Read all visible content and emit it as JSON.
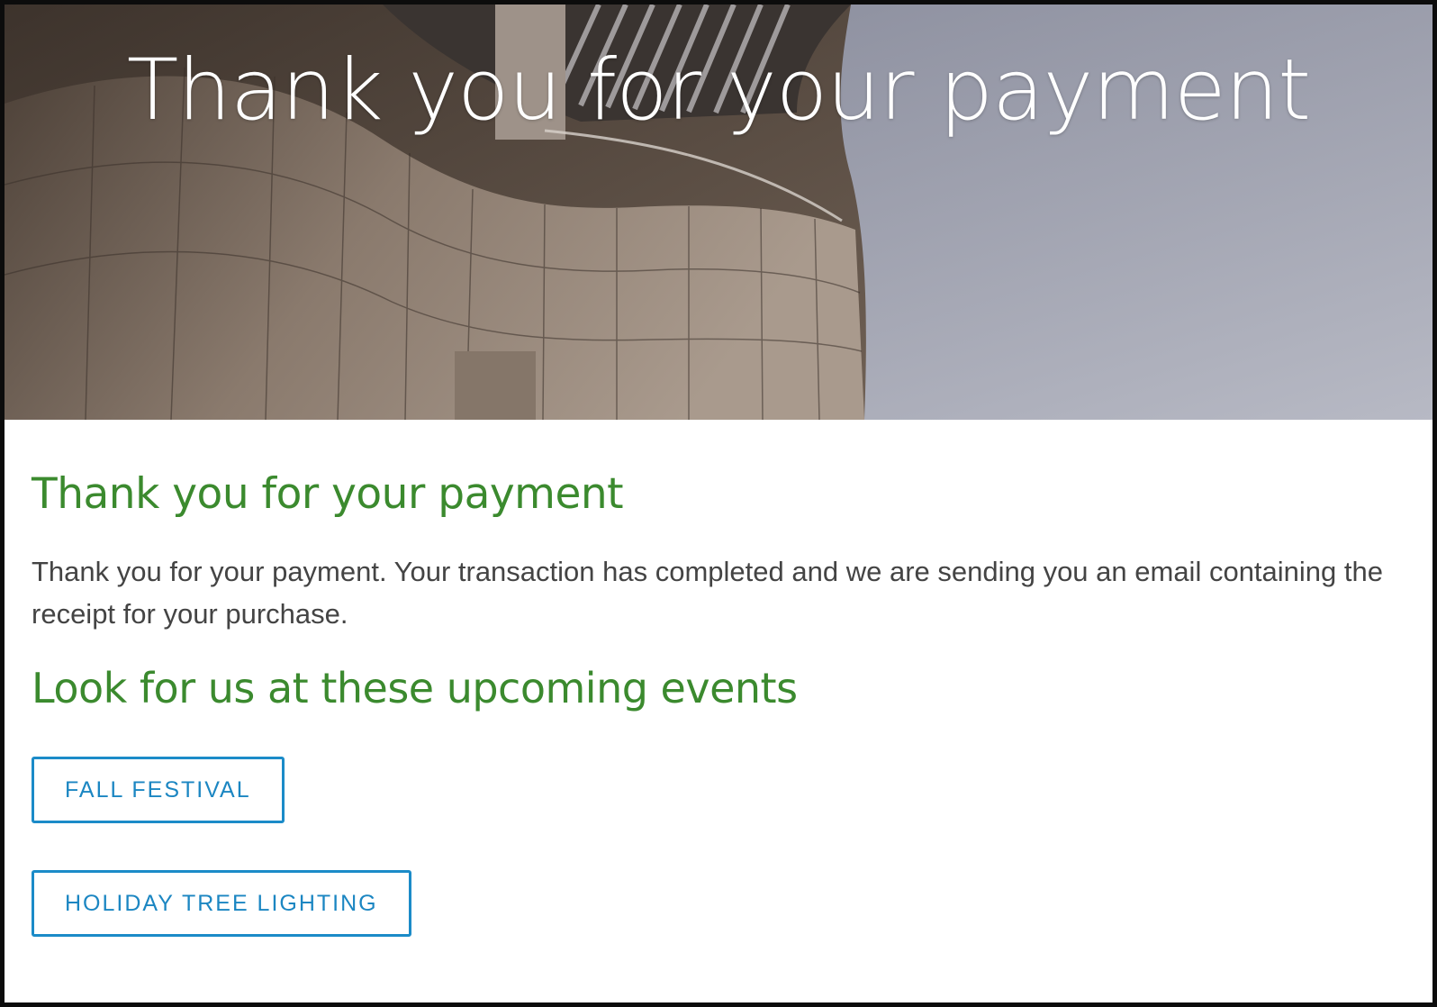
{
  "hero": {
    "title": "Thank you for your payment"
  },
  "main": {
    "heading": "Thank you for your payment",
    "message": "Thank you for your payment. Your transaction has completed and we are sending you an email containing the receipt for your purchase.",
    "events_heading": "Look for us at these upcoming events",
    "events": [
      {
        "label": "FALL FESTIVAL"
      },
      {
        "label": "HOLIDAY TREE LIGHTING"
      }
    ]
  },
  "colors": {
    "heading_green": "#3b8a2e",
    "button_blue": "#1b8bc8",
    "body_text": "#444444",
    "frame_border": "#0c0c0c"
  }
}
